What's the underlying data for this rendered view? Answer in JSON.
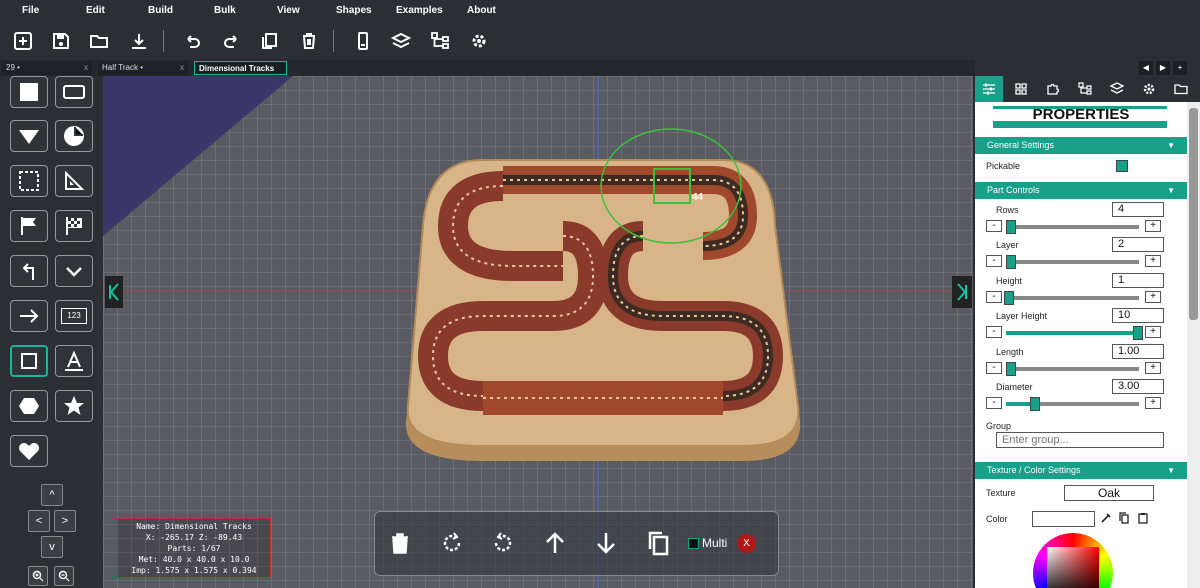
{
  "menu": [
    "File",
    "Edit",
    "Build",
    "Bulk",
    "View",
    "Shapes",
    "Examples",
    "About"
  ],
  "toolbar_icons": [
    "new-file-icon",
    "save-icon",
    "open-folder-icon",
    "download-icon",
    "undo-icon",
    "redo-icon",
    "duplicate-icon",
    "delete-icon",
    "phone-icon",
    "layers-icon",
    "hierarchy-icon",
    "settings-gear-icon"
  ],
  "tabs": [
    {
      "label": "29 •",
      "close": "x"
    },
    {
      "label": "Half Track •",
      "close": "x"
    },
    {
      "label": "Dimensional Tracks",
      "close": "x"
    }
  ],
  "tab_nav": [
    "◀",
    "▶",
    "+"
  ],
  "left_tools": [
    "square-fill-icon",
    "rounded-rect-icon",
    "triangle-icon",
    "pie-icon",
    "select-rect-icon",
    "ruler-triangle-icon",
    "flag-icon",
    "checkered-flag-icon",
    "turn-left-icon",
    "chevron-down-icon",
    "arrow-right-icon",
    "number-123-icon",
    "square-outline-icon",
    "text-a-icon",
    "hexagon-icon",
    "star-icon",
    "heart-icon"
  ],
  "text_123": "123",
  "pan_arrows": {
    "up": "^",
    "left": "<",
    "right": ">",
    "down": "v"
  },
  "zoom": [
    "zoom-in-icon",
    "zoom-out-icon"
  ],
  "viewport": {
    "hole_label": "44"
  },
  "info": {
    "name": "Name: Dimensional Tracks",
    "xz": "X: -265.17 Z: -89.43",
    "parts": "Parts: 1/67",
    "met": "Met: 40.0 x 40.0 x 10.0",
    "imp": "Imp: 1.575 x 1.575 x 0.394"
  },
  "bottom": {
    "multi": "Multi",
    "close": "X"
  },
  "panel": {
    "title": "PROPERTIES",
    "general": "General Settings",
    "pickable": "Pickable",
    "part_controls": "Part Controls",
    "rows_label": "Rows",
    "rows": "4",
    "rows_fraction": 0.0,
    "layer_label": "Layer",
    "layer": "2",
    "layer_fraction": 0.0,
    "height_label": "Height",
    "height": "1",
    "height_fraction": 0.0,
    "layer_height_label": "Layer Height",
    "layer_height": "10",
    "layer_height_fraction": 1.0,
    "length_label": "Length",
    "length": "1.00",
    "length_fraction": 0.0,
    "diameter_label": "Diameter",
    "diameter": "3.00",
    "diameter_fraction": 0.2,
    "group_label": "Group",
    "group_placeholder": "Enter group...",
    "texture_section": "Texture / Color Settings",
    "texture_label": "Texture",
    "texture": "Oak",
    "color_label": "Color",
    "minus": "-",
    "plus": "+",
    "tri": "▼"
  },
  "colors": {
    "accent": "#18a08a",
    "bg": "#2b2f33",
    "grid": "#ffffff",
    "wood": "#d8b588"
  }
}
